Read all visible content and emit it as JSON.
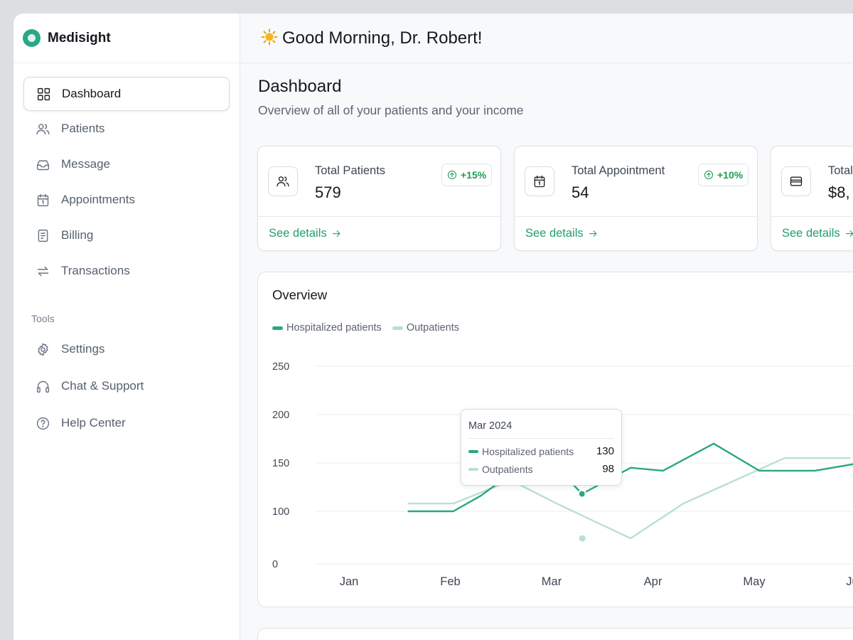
{
  "brand": {
    "name": "Medisight"
  },
  "greeting": "Good Morning, Dr. Robert!",
  "page": {
    "title": "Dashboard",
    "subtitle": "Overview of all of your patients and your income"
  },
  "nav": {
    "items": [
      {
        "label": "Dashboard",
        "icon": "grid-icon"
      },
      {
        "label": "Patients",
        "icon": "users-icon"
      },
      {
        "label": "Message",
        "icon": "inbox-icon"
      },
      {
        "label": "Appointments",
        "icon": "calendar-icon"
      },
      {
        "label": "Billing",
        "icon": "document-icon"
      },
      {
        "label": "Transactions",
        "icon": "transfer-arrows-icon"
      }
    ],
    "tools_label": "Tools",
    "tools": [
      {
        "label": "Settings",
        "icon": "gear-icon"
      },
      {
        "label": "Chat & Support",
        "icon": "headphones-icon"
      },
      {
        "label": "Help Center",
        "icon": "help-circle-icon"
      }
    ]
  },
  "cards": [
    {
      "label": "Total Patients",
      "value": "579",
      "badge": "+15%",
      "link": "See details",
      "icon": "users-icon"
    },
    {
      "label": "Total Appointment",
      "value": "54",
      "badge": "+10%",
      "link": "See details",
      "icon": "calendar-icon"
    },
    {
      "label": "Total",
      "value": "$8,",
      "link": "See details",
      "icon": "wallet-icon"
    }
  ],
  "overview": {
    "title": "Overview",
    "tooltip": {
      "title": "Mar 2024",
      "rows": [
        {
          "label": "Hospitalized patients",
          "value": "130"
        },
        {
          "label": "Outpatients",
          "value": "98"
        }
      ]
    }
  },
  "colors": {
    "accent": "#22a06b",
    "hospitalized": "#2aa87a",
    "outpatients": "#b9e0cf",
    "badge": "#1f9e55"
  },
  "chart_data": {
    "type": "line",
    "title": "Overview",
    "xlabel": "",
    "ylabel": "",
    "categories": [
      "Jan",
      "Feb",
      "Mar",
      "Apr",
      "May",
      "Jun"
    ],
    "y_ticks": [
      "250",
      "200",
      "150",
      "100",
      "0"
    ],
    "ylim": [
      0,
      250
    ],
    "grid": true,
    "legend_position": "top-left",
    "series": [
      {
        "name": "Hospitalized patients",
        "color": "#2aa87a",
        "x": [
          0.58,
          1.03,
          1.3,
          1.9,
          2.3,
          2.78,
          3.1,
          3.6,
          4.05,
          4.6,
          5.05
        ],
        "values": [
          100,
          100,
          116,
          162,
          118,
          145,
          142,
          170,
          142,
          142,
          150
        ]
      },
      {
        "name": "Outpatients",
        "color": "#b9e0cf",
        "x": [
          0.58,
          1.03,
          1.6,
          2.05,
          2.78,
          3.3,
          4.3,
          4.95
        ],
        "values": [
          108,
          108,
          132,
          108,
          72,
          108,
          155,
          155
        ]
      }
    ],
    "highlight": {
      "category": "Mar",
      "values": [
        130,
        98
      ]
    }
  }
}
